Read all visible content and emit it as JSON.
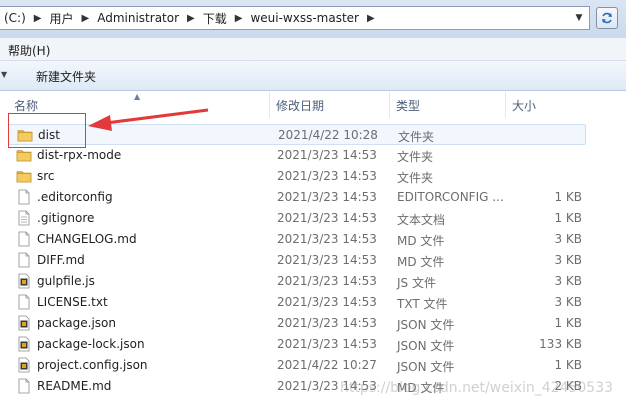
{
  "address": {
    "crumbs": [
      "(C:)",
      "用户",
      "Administrator",
      "下载",
      "weui-wxss-master"
    ]
  },
  "menu": {
    "help": "帮助(H)"
  },
  "command_bar": {
    "new_folder": "新建文件夹"
  },
  "columns": {
    "name": "名称",
    "date": "修改日期",
    "type": "类型",
    "size": "大小"
  },
  "files": [
    {
      "name": "dist",
      "date": "2021/4/22 10:28",
      "type": "文件夹",
      "size": "",
      "icon": "folder-icon"
    },
    {
      "name": "dist-rpx-mode",
      "date": "2021/3/23 14:53",
      "type": "文件夹",
      "size": "",
      "icon": "folder-icon"
    },
    {
      "name": "src",
      "date": "2021/3/23 14:53",
      "type": "文件夹",
      "size": "",
      "icon": "folder-icon"
    },
    {
      "name": ".editorconfig",
      "date": "2021/3/23 14:53",
      "type": "EDITORCONFIG ...",
      "size": "1 KB",
      "icon": "file-icon"
    },
    {
      "name": ".gitignore",
      "date": "2021/3/23 14:53",
      "type": "文本文档",
      "size": "1 KB",
      "icon": "text-file-icon"
    },
    {
      "name": "CHANGELOG.md",
      "date": "2021/3/23 14:53",
      "type": "MD 文件",
      "size": "3 KB",
      "icon": "file-icon"
    },
    {
      "name": "DIFF.md",
      "date": "2021/3/23 14:53",
      "type": "MD 文件",
      "size": "3 KB",
      "icon": "file-icon"
    },
    {
      "name": "gulpfile.js",
      "date": "2021/3/23 14:53",
      "type": "JS 文件",
      "size": "3 KB",
      "icon": "script-file-icon"
    },
    {
      "name": "LICENSE.txt",
      "date": "2021/3/23 14:53",
      "type": "TXT 文件",
      "size": "3 KB",
      "icon": "file-icon"
    },
    {
      "name": "package.json",
      "date": "2021/3/23 14:53",
      "type": "JSON 文件",
      "size": "1 KB",
      "icon": "script-file-icon"
    },
    {
      "name": "package-lock.json",
      "date": "2021/3/23 14:53",
      "type": "JSON 文件",
      "size": "133 KB",
      "icon": "script-file-icon"
    },
    {
      "name": "project.config.json",
      "date": "2021/4/22 10:27",
      "type": "JSON 文件",
      "size": "1 KB",
      "icon": "script-file-icon"
    },
    {
      "name": "README.md",
      "date": "2021/3/23 14:53",
      "type": "MD 文件",
      "size": "2 KB",
      "icon": "file-icon"
    }
  ],
  "watermark": "https://blog.csdn.net/weixin_42450533",
  "colors": {
    "folder": "#e8b33a",
    "annotation": "#e23a3a",
    "selection_bg": "#f2f7fd"
  }
}
